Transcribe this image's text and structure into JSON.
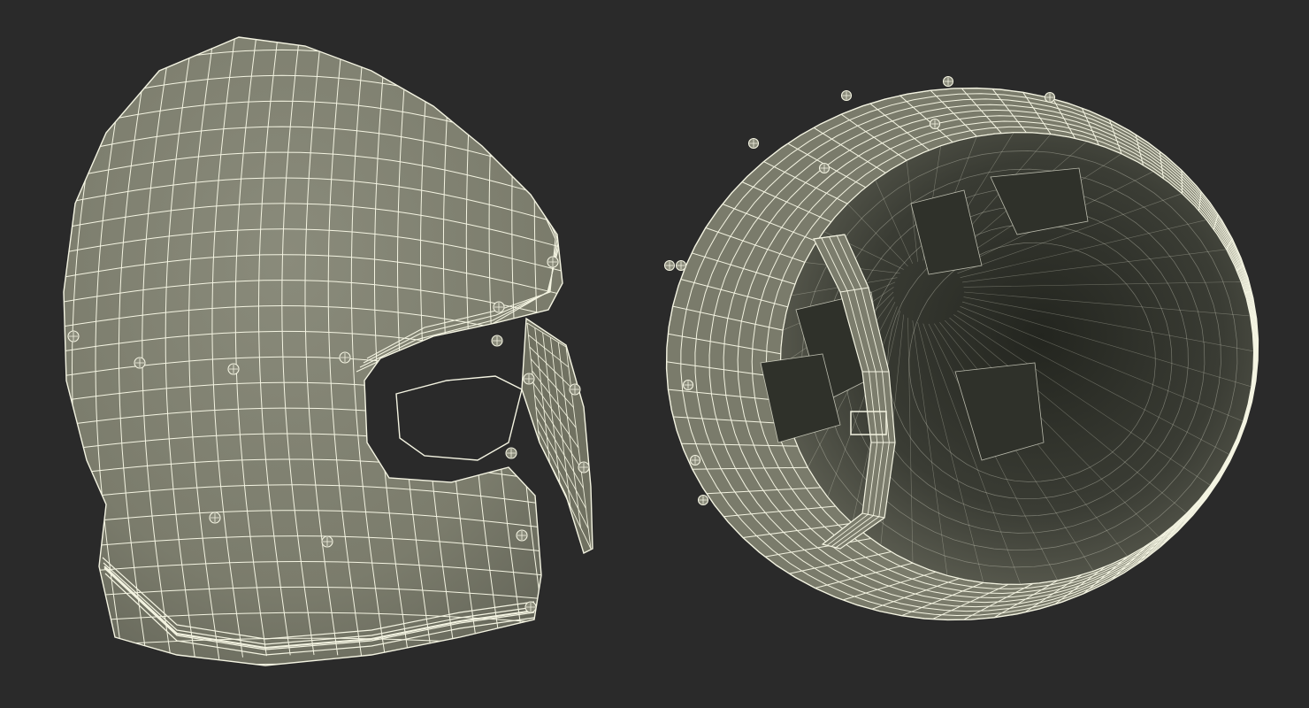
{
  "scene": {
    "description_visible_text": "",
    "colors": {
      "background": "#2a2a2a",
      "mesh_fill": "#7f8070",
      "mesh_fill_dark": "#5d5f52",
      "interior_fill": "#3b3d35",
      "interior_deep": "#24261f",
      "wire": "#f4f4e2",
      "wire_dim": "#d9dac8"
    },
    "objects": [
      {
        "name": "helmet-exterior-view"
      },
      {
        "name": "helmet-interior-view"
      }
    ]
  }
}
